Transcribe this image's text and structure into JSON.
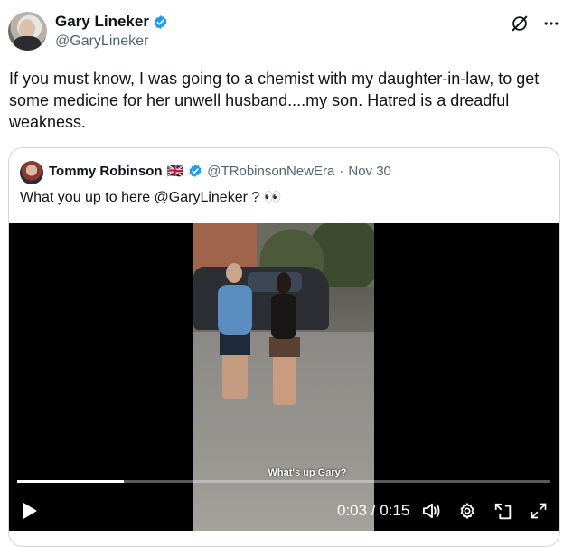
{
  "tweet": {
    "author_name": "Gary Lineker",
    "author_handle": "@GaryLineker",
    "text": "If you must know, I was going to a chemist with my daughter-in-law, to get some medicine for her unwell husband....my son. Hatred is a dreadful weakness."
  },
  "header_icons": [
    "grok-icon",
    "more-options-icon"
  ],
  "quote": {
    "author_name": "Tommy Robinson",
    "flag": "🇬🇧",
    "handle": "@TRobinsonNewEra",
    "separator": "·",
    "date": "Nov 30",
    "text": "What you up to here @GaryLineker ? 👀"
  },
  "video": {
    "caption": "What's up Gary?",
    "time_display": "0:03 / 0:15",
    "progress_fraction": 0.2,
    "controls": [
      "play-icon",
      "volume-icon",
      "settings-icon",
      "pip-icon",
      "fullscreen-icon"
    ]
  },
  "colors": {
    "verified": "#1d9bf0",
    "secondary_text": "#536471",
    "border": "#cfd9de"
  }
}
